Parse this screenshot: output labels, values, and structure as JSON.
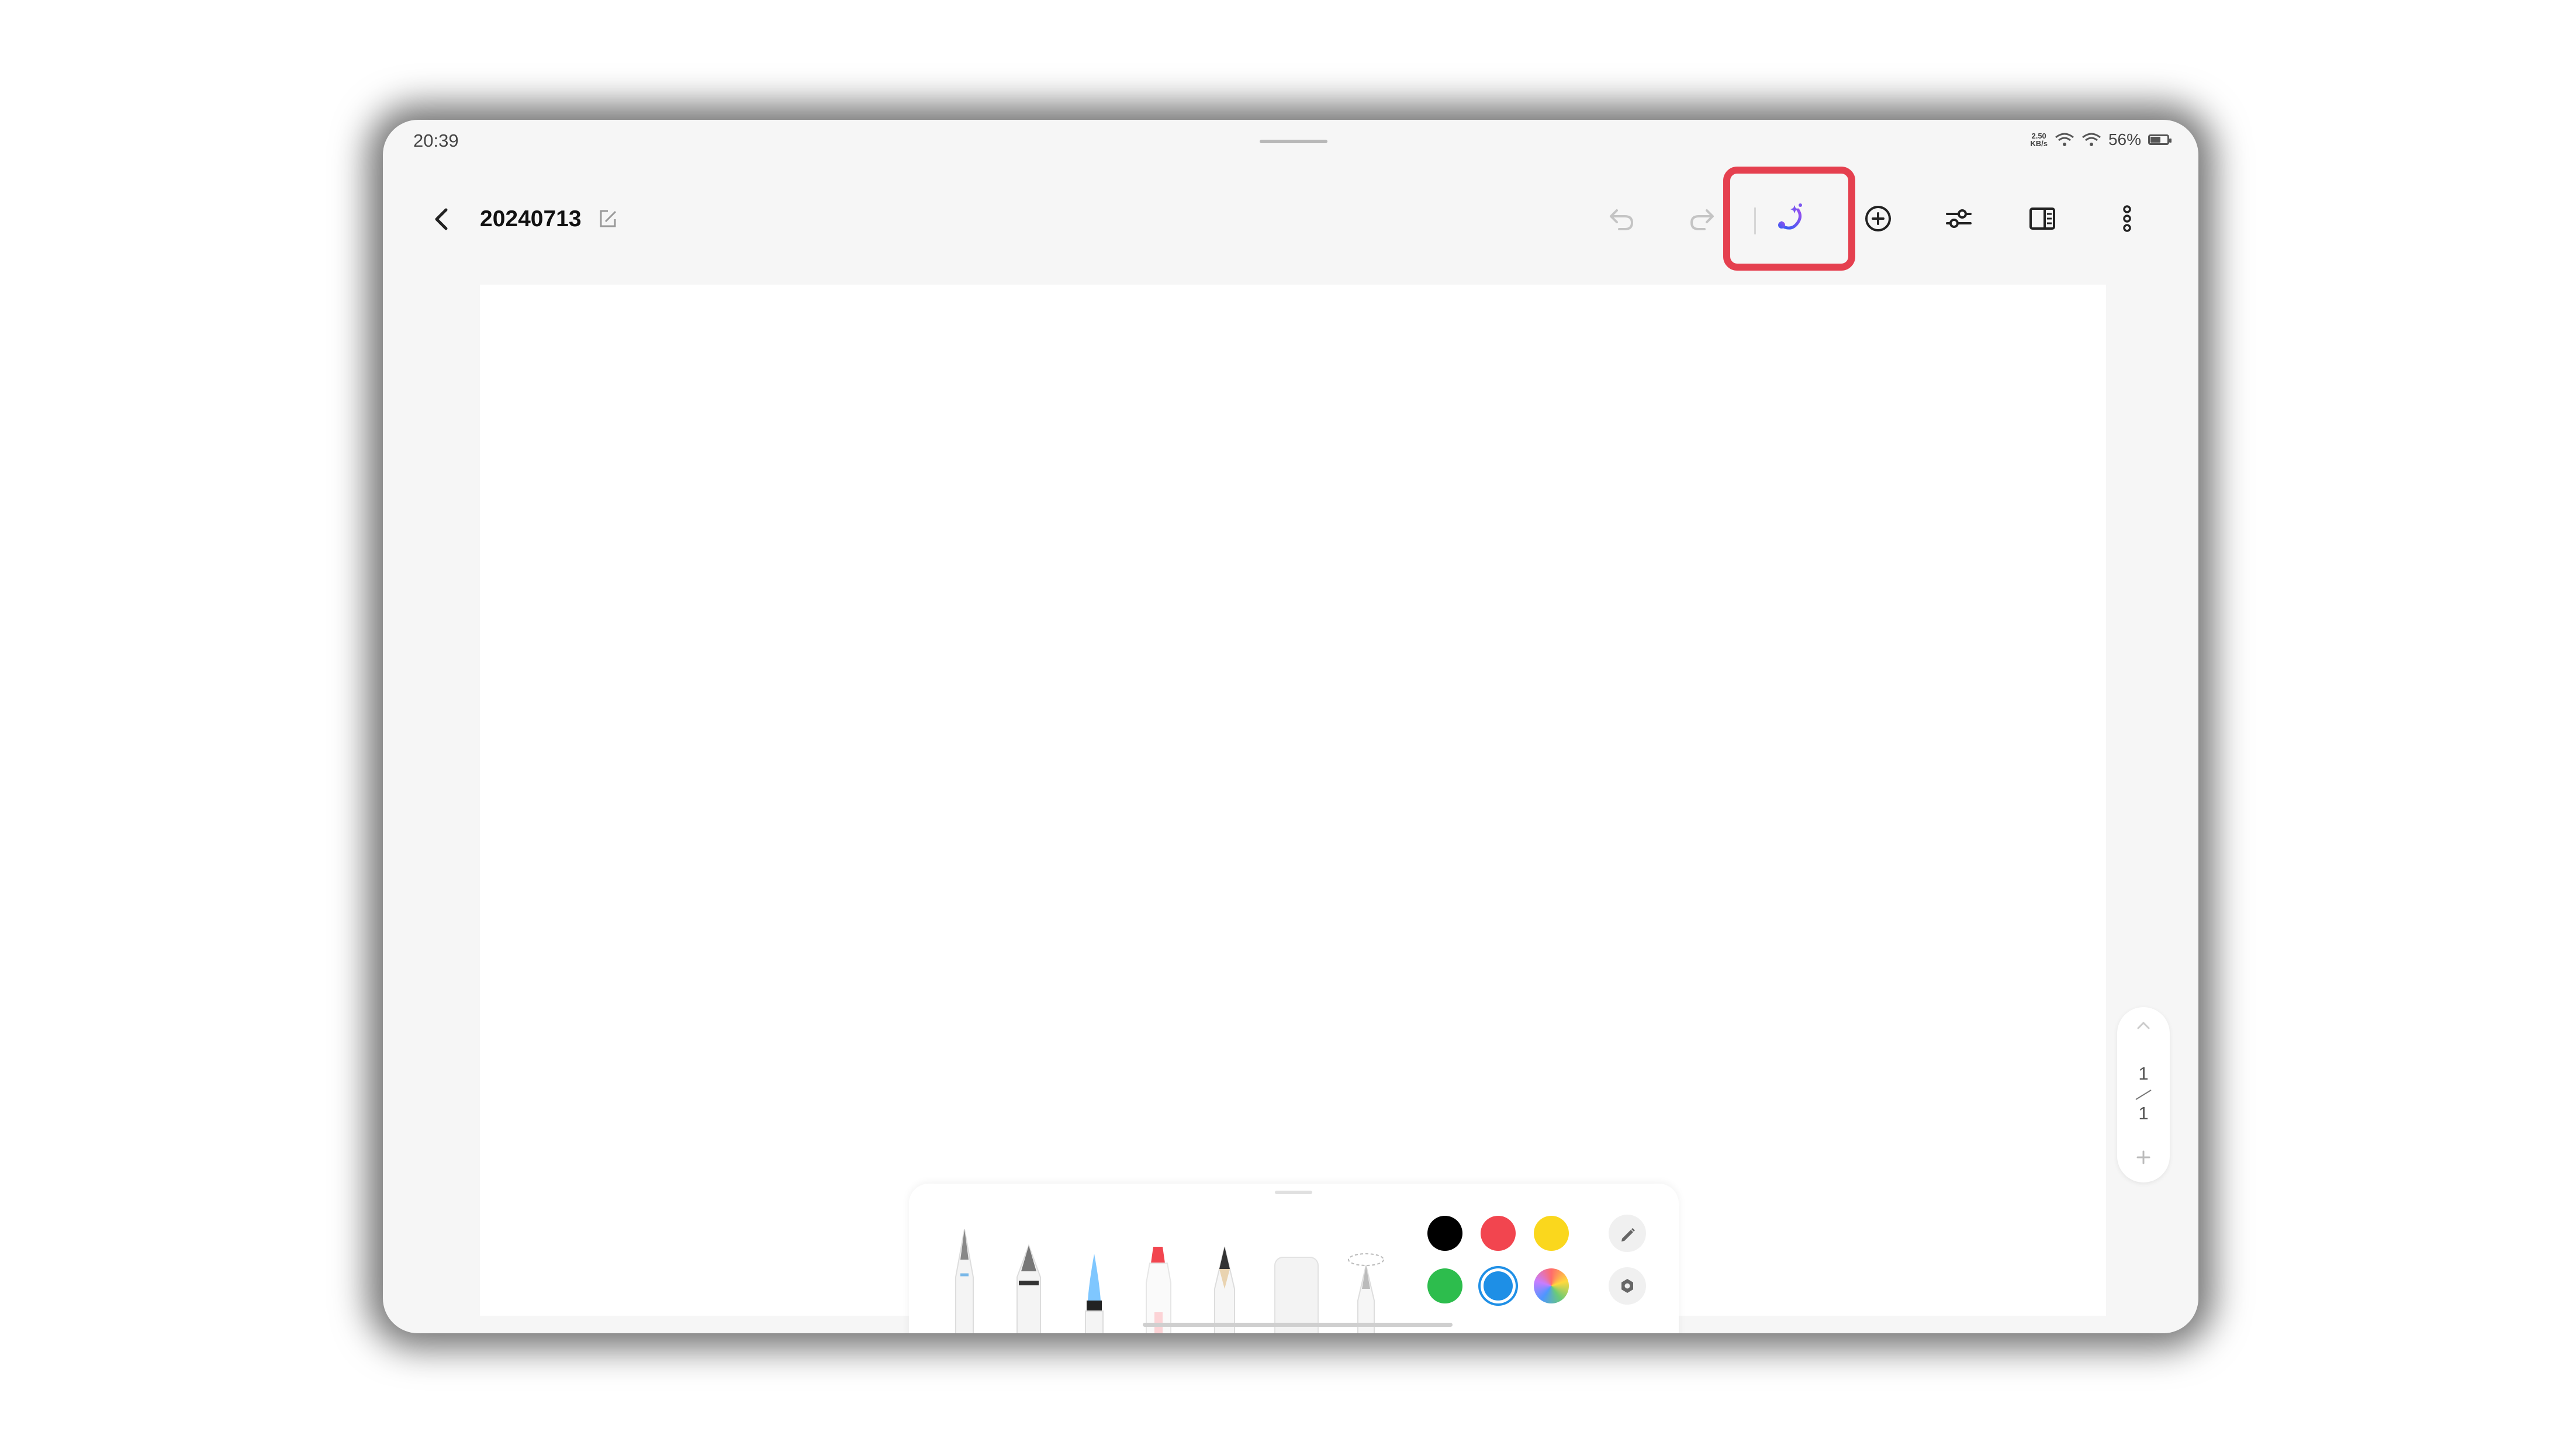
{
  "status_bar": {
    "time": "20:39",
    "net_speed_value": "2.50",
    "net_speed_unit": "KB/s",
    "battery": "56%",
    "battery_level": 0.56
  },
  "toolbar": {
    "title": "20240713",
    "icons": [
      "back-icon",
      "rename-icon",
      "undo-icon",
      "redo-icon",
      "ai-brush-icon",
      "add-icon",
      "adjust-icon",
      "split-view-icon",
      "more-icon"
    ]
  },
  "page_nav": {
    "current": "1",
    "total": "1"
  },
  "pen_toolbar": {
    "tools": [
      "ballpoint-pen",
      "fountain-pen",
      "brush-pen",
      "highlighter",
      "pencil",
      "eraser",
      "lasso"
    ],
    "colors": [
      "#000000",
      "#f2454f",
      "#fad71d",
      "#2dbd4d",
      "#1e8fe6",
      "rainbow"
    ],
    "selected_color": "#1e8fe6",
    "accent": "#e5404f"
  }
}
